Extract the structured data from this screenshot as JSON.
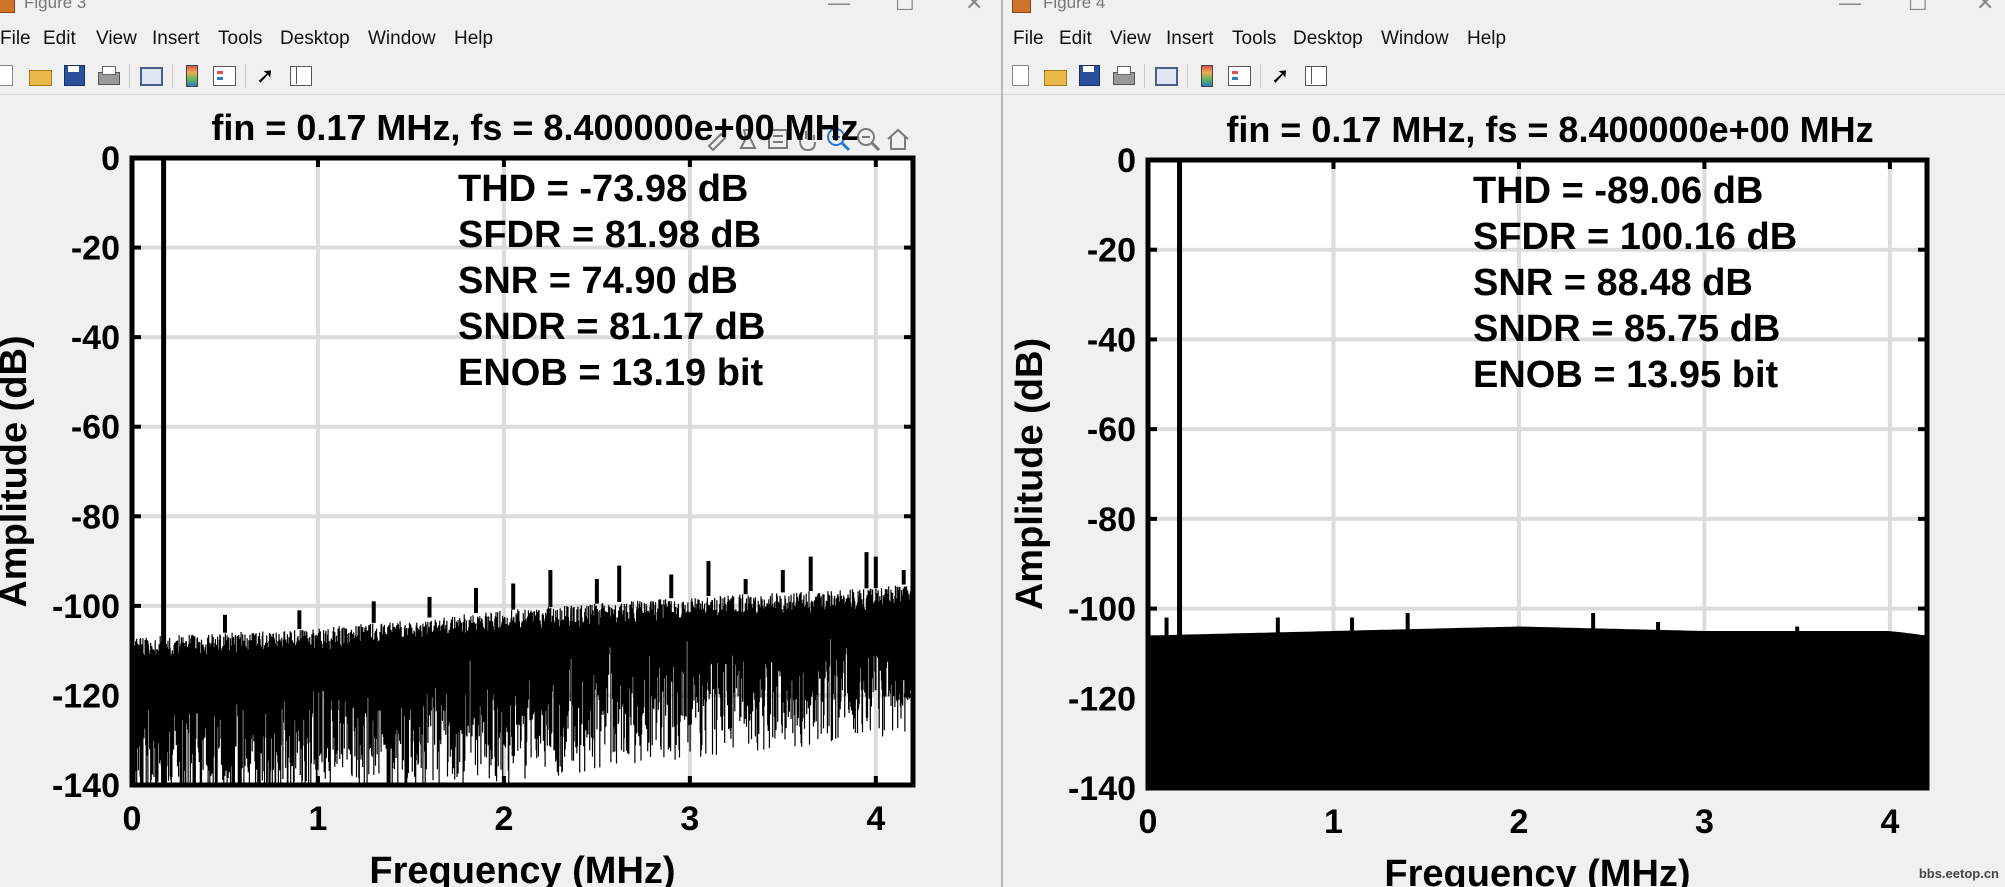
{
  "windows": [
    {
      "title": "Figure 3",
      "menus": [
        "File",
        "Edit",
        "View",
        "Insert",
        "Tools",
        "Desktop",
        "Window",
        "Help"
      ],
      "axes_toolbar": [
        "brush-icon",
        "data-tips-icon",
        "legend-icon",
        "pan-icon",
        "zoom-in-icon",
        "zoom-out-icon",
        "home-icon"
      ],
      "plot_title": "fin = 0.17 MHz,  fs = 8.400000e+00 MHz",
      "metrics": [
        "THD = -73.98 dB",
        "SFDR = 81.98 dB",
        "SNR = 74.90 dB",
        "SNDR = 81.17 dB",
        "ENOB = 13.19 bit"
      ]
    },
    {
      "title": "Figure 4",
      "menus": [
        "File",
        "Edit",
        "View",
        "Insert",
        "Tools",
        "Desktop",
        "Window",
        "Help"
      ],
      "plot_title": "fin = 0.17 MHz,  fs = 8.400000e+00 MHz",
      "metrics": [
        "THD = -89.06 dB",
        "SFDR = 100.16 dB",
        "SNR = 88.48 dB",
        "SNDR = 85.75 dB",
        "ENOB = 13.95 bit"
      ]
    }
  ],
  "watermark": "bbs.eetop.cn",
  "colors": {
    "trace": "#000000",
    "grid": "#dcdcdc",
    "axes": "#000000",
    "background": "#ffffff",
    "window": "#f0f0f0"
  },
  "chart_data": [
    {
      "type": "line",
      "title": "fin = 0.17 MHz,  fs = 8.400000e+00 MHz",
      "xlabel": "Frequency (MHz)",
      "ylabel": "Amplitude (dB)",
      "xlim": [
        0,
        4.2
      ],
      "ylim": [
        -140,
        0
      ],
      "xticks": [
        0,
        1,
        2,
        3,
        4
      ],
      "yticks": [
        0,
        -20,
        -40,
        -60,
        -80,
        -100,
        -120,
        -140
      ],
      "grid": true,
      "annotations": [
        "THD = -73.98 dB",
        "SFDR = 81.98 dB",
        "SNR = 74.90 dB",
        "SNDR = 81.17 dB",
        "ENOB = 13.19 bit"
      ],
      "series": [
        {
          "fundamental": {
            "x": 0.17,
            "y": 0
          },
          "noise_floor": {
            "x": [
              0,
              1,
              2,
              3,
              4,
              4.2
            ],
            "upper": [
              -107,
              -105,
              -101,
              -98,
              -96,
              -95
            ],
            "lower": [
              -140,
              -138,
              -134,
              -128,
              -124,
              -122
            ]
          },
          "spurs": [
            {
              "x": 0.5,
              "y": -102
            },
            {
              "x": 0.9,
              "y": -101
            },
            {
              "x": 1.3,
              "y": -99
            },
            {
              "x": 1.6,
              "y": -98
            },
            {
              "x": 1.85,
              "y": -96
            },
            {
              "x": 2.05,
              "y": -95
            },
            {
              "x": 2.25,
              "y": -92
            },
            {
              "x": 2.5,
              "y": -94
            },
            {
              "x": 2.62,
              "y": -91
            },
            {
              "x": 2.9,
              "y": -93
            },
            {
              "x": 3.1,
              "y": -90
            },
            {
              "x": 3.3,
              "y": -94
            },
            {
              "x": 3.5,
              "y": -92
            },
            {
              "x": 3.65,
              "y": -89
            },
            {
              "x": 3.95,
              "y": -88
            },
            {
              "x": 4.0,
              "y": -89
            },
            {
              "x": 4.15,
              "y": -92
            }
          ]
        }
      ]
    },
    {
      "type": "line",
      "title": "fin = 0.17 MHz,  fs = 8.400000e+00 MHz",
      "xlabel": "Frequency (MHz)",
      "ylabel": "Amplitude (dB)",
      "xlim": [
        0,
        4.2
      ],
      "ylim": [
        -140,
        0
      ],
      "xticks": [
        0,
        1,
        2,
        3,
        4
      ],
      "yticks": [
        0,
        -20,
        -40,
        -60,
        -80,
        -100,
        -120,
        -140
      ],
      "grid": true,
      "annotations": [
        "THD = -89.06 dB",
        "SFDR = 100.16 dB",
        "SNR = 88.48 dB",
        "SNDR = 85.75 dB",
        "ENOB = 13.95 bit"
      ],
      "series": [
        {
          "fundamental": {
            "x": 0.17,
            "y": 0
          },
          "noise_floor": {
            "x": [
              0,
              1,
              2,
              3,
              4,
              4.2
            ],
            "upper": [
              -108,
              -107,
              -106,
              -107,
              -107,
              -108
            ],
            "lower": [
              -140,
              -140,
              -140,
              -140,
              -140,
              -140
            ]
          },
          "spurs": [
            {
              "x": 0.1,
              "y": -102
            },
            {
              "x": 0.7,
              "y": -102
            },
            {
              "x": 1.1,
              "y": -102
            },
            {
              "x": 1.4,
              "y": -101
            },
            {
              "x": 2.4,
              "y": -101
            },
            {
              "x": 2.75,
              "y": -103
            },
            {
              "x": 3.5,
              "y": -104
            }
          ]
        }
      ]
    }
  ]
}
